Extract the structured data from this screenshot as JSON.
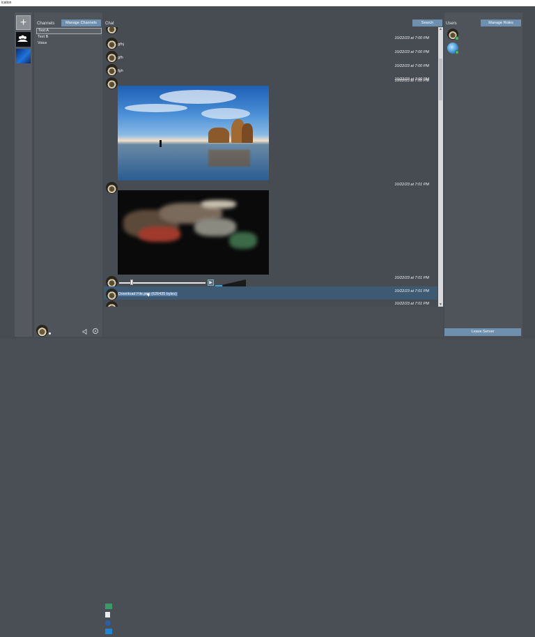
{
  "window": {
    "title": "ication"
  },
  "rail": {
    "add_glyph": "+",
    "servers": [
      {
        "icon": "group-icon"
      },
      {
        "icon": "windows-wallpaper-icon"
      }
    ]
  },
  "channels": {
    "label": "Channels",
    "manage_button": "Manage Channels",
    "items": [
      "Text A",
      "Text B",
      "Voice"
    ],
    "selected": "Text A"
  },
  "chat": {
    "label": "Chat",
    "search_button": "Search",
    "messages": [
      {
        "text": "",
        "time": "10/22/23 at 7:00 PM"
      },
      {
        "text": "gfhj",
        "time": "10/22/23 at 7:00 PM"
      },
      {
        "text": "gfh",
        "time": "10/22/23 at 7:00 PM"
      },
      {
        "text": "fgh",
        "time": "10/22/23 at 7:00 PM"
      },
      {
        "text": "",
        "time": "10/22/23 at 7:00 PM"
      },
      {
        "text": "",
        "time": "10/22/23 at 7:01 PM"
      },
      {
        "text": "",
        "time": "10/22/23 at 7:01 PM"
      },
      {
        "text": "Download File.png (626435 bytes)",
        "time": "10/22/23 at 7:01 PM"
      },
      {
        "text": "",
        "time": "10/22/23 at 7:01 PM"
      }
    ],
    "play_glyph": "▶"
  },
  "users": {
    "label": "Users",
    "manage_button": "Manage Roles",
    "leave_button": "Leave Server"
  },
  "colors": {
    "accent": "#6f8fae",
    "background": "#474b52",
    "highlight_row": "#3e5a73",
    "online": "#3cc45a"
  }
}
